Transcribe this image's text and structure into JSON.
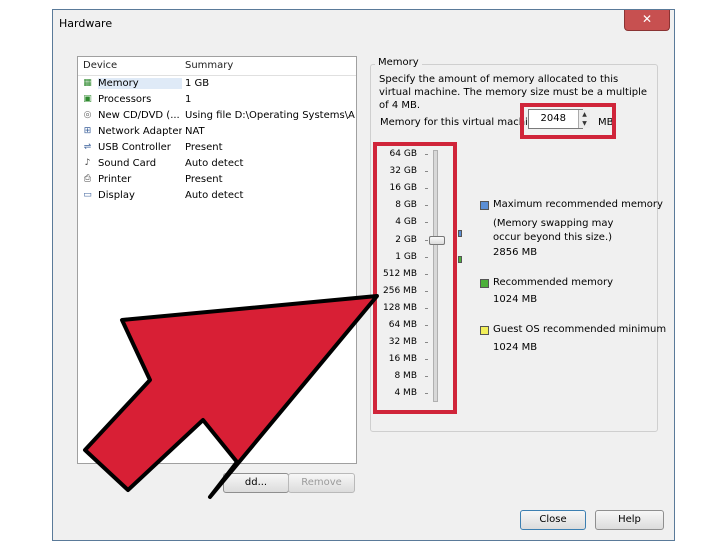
{
  "window": {
    "title": "Hardware",
    "close_glyph": "✕"
  },
  "device_list": {
    "headers": {
      "device": "Device",
      "summary": "Summary"
    },
    "rows": [
      {
        "name": "Memory",
        "summary": "1 GB",
        "icon": "memory-icon",
        "selected": true
      },
      {
        "name": "Processors",
        "summary": "1",
        "icon": "processor-icon"
      },
      {
        "name": "New CD/DVD (...",
        "summary": "Using file D:\\Operating Systems\\A...",
        "icon": "cd-dvd-icon"
      },
      {
        "name": "Network Adapter",
        "summary": "NAT",
        "icon": "network-adapter-icon"
      },
      {
        "name": "USB Controller",
        "summary": "Present",
        "icon": "usb-icon"
      },
      {
        "name": "Sound Card",
        "summary": "Auto detect",
        "icon": "sound-card-icon"
      },
      {
        "name": "Printer",
        "summary": "Present",
        "icon": "printer-icon"
      },
      {
        "name": "Display",
        "summary": "Auto detect",
        "icon": "display-icon"
      }
    ]
  },
  "buttons": {
    "add": "Add...",
    "add_visible": "dd...",
    "remove": "Remove",
    "close": "Close",
    "help": "Help"
  },
  "memory": {
    "group_title": "Memory",
    "description": "Specify the amount of memory allocated to this virtual machine. The memory size must be a multiple of 4 MB.",
    "field_label": "Memory for this virtual machine",
    "value": "2048",
    "unit": "MB",
    "scale": [
      "64 GB",
      "32 GB",
      "16 GB",
      "8 GB",
      "4 GB",
      "2 GB",
      "1 GB",
      "512 MB",
      "256 MB",
      "128 MB",
      "64 MB",
      "32 MB",
      "16 MB",
      "8 MB",
      "4 MB"
    ],
    "slider_level": "2 GB",
    "legend": {
      "max_title": "Maximum recommended memory",
      "max_note": "(Memory swapping may occur beyond this size.)",
      "max_value": "2856 MB",
      "rec_title": "Recommended memory",
      "rec_value": "1024 MB",
      "min_title": "Guest OS recommended minimum",
      "min_value": "1024 MB"
    }
  },
  "colors": {
    "highlight": "#d0253a",
    "max_marker": "#5b8fd6",
    "rec_marker": "#4caf3a",
    "min_marker": "#f2ef5a"
  }
}
